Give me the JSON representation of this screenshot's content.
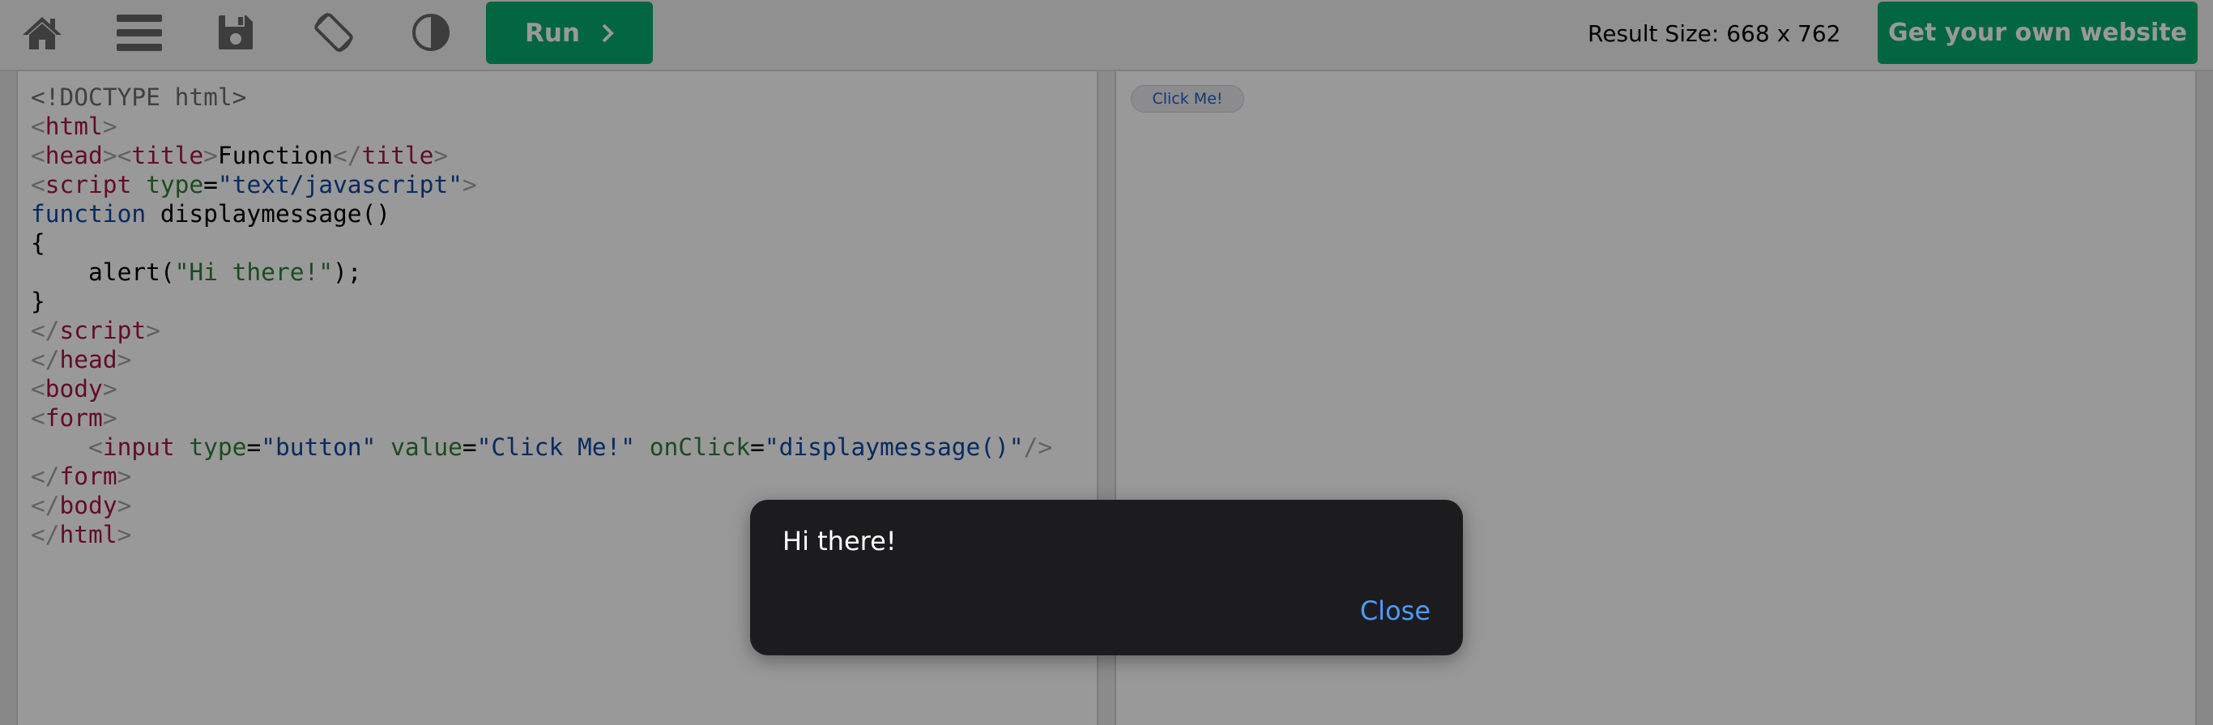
{
  "toolbar": {
    "icons": [
      "home-icon",
      "menu-icon",
      "save-icon",
      "rotate-icon",
      "contrast-icon"
    ],
    "run_label": "Run",
    "result_size": "Result Size: 668 x 762",
    "own_site_label": "Get your own website"
  },
  "code_lines": [
    [
      {
        "t": "doc",
        "v": "<!DOCTYPE html>"
      }
    ],
    [
      {
        "t": "br",
        "v": "<"
      },
      {
        "t": "tag",
        "v": "html"
      },
      {
        "t": "br",
        "v": ">"
      }
    ],
    [
      {
        "t": "br",
        "v": "<"
      },
      {
        "t": "tag",
        "v": "head"
      },
      {
        "t": "br",
        "v": "><"
      },
      {
        "t": "tag",
        "v": "title"
      },
      {
        "t": "br",
        "v": ">"
      },
      {
        "t": "txt",
        "v": "Function"
      },
      {
        "t": "br",
        "v": "</"
      },
      {
        "t": "tag",
        "v": "title"
      },
      {
        "t": "br",
        "v": ">"
      }
    ],
    [
      {
        "t": "br",
        "v": "<"
      },
      {
        "t": "tag",
        "v": "script"
      },
      {
        "t": "txt",
        "v": " "
      },
      {
        "t": "attr",
        "v": "type"
      },
      {
        "t": "txt",
        "v": "="
      },
      {
        "t": "str",
        "v": "\"text/javascript\""
      },
      {
        "t": "br",
        "v": ">"
      }
    ],
    [
      {
        "t": "kw",
        "v": "function"
      },
      {
        "t": "txt",
        "v": " displaymessage()"
      }
    ],
    [
      {
        "t": "txt",
        "v": "{"
      }
    ],
    [
      {
        "t": "txt",
        "v": "    alert("
      },
      {
        "t": "attr",
        "v": "\"Hi there!\""
      },
      {
        "t": "txt",
        "v": ");"
      }
    ],
    [
      {
        "t": "txt",
        "v": "}"
      }
    ],
    [
      {
        "t": "br",
        "v": "</"
      },
      {
        "t": "tag",
        "v": "script"
      },
      {
        "t": "br",
        "v": ">"
      }
    ],
    [
      {
        "t": "br",
        "v": "</"
      },
      {
        "t": "tag",
        "v": "head"
      },
      {
        "t": "br",
        "v": ">"
      }
    ],
    [
      {
        "t": "br",
        "v": "<"
      },
      {
        "t": "tag",
        "v": "body"
      },
      {
        "t": "br",
        "v": ">"
      }
    ],
    [
      {
        "t": "br",
        "v": "<"
      },
      {
        "t": "tag",
        "v": "form"
      },
      {
        "t": "br",
        "v": ">"
      }
    ],
    [
      {
        "t": "txt",
        "v": "    "
      },
      {
        "t": "br",
        "v": "<"
      },
      {
        "t": "tag",
        "v": "input"
      },
      {
        "t": "txt",
        "v": " "
      },
      {
        "t": "attr",
        "v": "type"
      },
      {
        "t": "txt",
        "v": "="
      },
      {
        "t": "str",
        "v": "\"button\""
      },
      {
        "t": "txt",
        "v": " "
      },
      {
        "t": "attr",
        "v": "value"
      },
      {
        "t": "txt",
        "v": "="
      },
      {
        "t": "str",
        "v": "\"Click Me!\""
      },
      {
        "t": "txt",
        "v": " "
      },
      {
        "t": "attr",
        "v": "onClick"
      },
      {
        "t": "txt",
        "v": "="
      },
      {
        "t": "str",
        "v": "\"displaymessage()\""
      },
      {
        "t": "br",
        "v": "/>"
      }
    ],
    [
      {
        "t": "br",
        "v": "</"
      },
      {
        "t": "tag",
        "v": "form"
      },
      {
        "t": "br",
        "v": ">"
      }
    ],
    [
      {
        "t": "br",
        "v": "</"
      },
      {
        "t": "tag",
        "v": "body"
      },
      {
        "t": "br",
        "v": ">"
      }
    ],
    [
      {
        "t": "br",
        "v": "</"
      },
      {
        "t": "tag",
        "v": "html"
      },
      {
        "t": "br",
        "v": ">"
      }
    ]
  ],
  "result": {
    "button_label": "Click Me!"
  },
  "alert": {
    "message": "Hi there!",
    "close_label": "Close"
  },
  "colors": {
    "accent": "#04aa6d",
    "tag": "#a31545",
    "attribute": "#2e7d32",
    "string": "#0d47a1",
    "bracket": "#a0a0a0",
    "alert_background": "#1c1c1e",
    "alert_link": "#4c9cff"
  }
}
